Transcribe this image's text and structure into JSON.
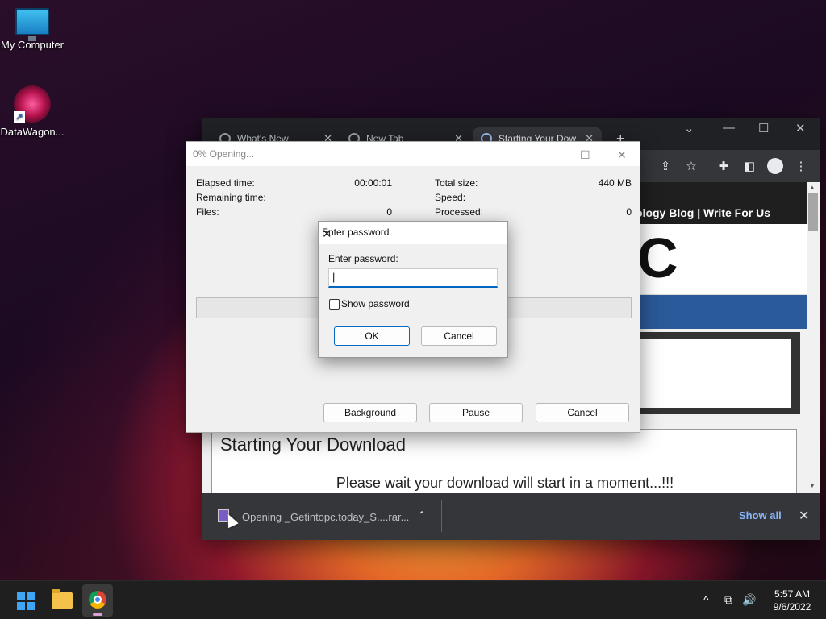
{
  "desktop": {
    "icons": [
      {
        "label": "My Computer",
        "icon": "monitor-icon"
      },
      {
        "label": "DataWagon...",
        "icon": "datawagon-flower-icon"
      }
    ]
  },
  "browser": {
    "tabs": [
      {
        "label": "What's New",
        "close": "✕"
      },
      {
        "label": "New Tab",
        "close": "✕"
      },
      {
        "label": "Starting Your Dow",
        "close": "✕"
      }
    ],
    "new_tab": "+",
    "window_controls": {
      "dropdown": "⌄",
      "minimize": "—",
      "maximize": "☐",
      "close": "✕"
    },
    "toolbar_icons": [
      "share-icon",
      "bookmark-star-icon",
      "extensions-icon",
      "side-panel-icon",
      "profile-icon",
      "menu-icon"
    ],
    "page": {
      "nav_text": "ology Blog | Write For Us",
      "logo_fragment": "C",
      "heading": "Starting Your Download",
      "message": "Please wait your download will start in a moment...!!!"
    },
    "download_bar": {
      "item_text": "Opening _Getintopc.today_S....rar...",
      "chevron": "⌃",
      "show_all": "Show all",
      "close": "✕"
    }
  },
  "opening_dialog": {
    "title": "0% Opening...",
    "controls": {
      "minimize": "—",
      "maximize": "☐",
      "close": "✕"
    },
    "left_labels": [
      "Elapsed time:",
      "Remaining time:",
      "Files:"
    ],
    "left_values": [
      "00:00:01",
      "",
      "0"
    ],
    "right_labels": [
      "Total size:",
      "Speed:",
      "Processed:"
    ],
    "right_values": [
      "440 MB",
      "",
      "0"
    ],
    "progress_fraction": 0.0,
    "buttons": {
      "background": "Background",
      "pause": "Pause",
      "cancel": "Cancel"
    }
  },
  "password_dialog": {
    "title": "Enter password",
    "close": "✕",
    "field_label": "Enter password:",
    "field_value": "",
    "cursor": "|",
    "show_password_label": "Show password",
    "show_password_checked": false,
    "ok": "OK",
    "cancel": "Cancel"
  },
  "taskbar": {
    "apps": [
      "start-icon",
      "file-explorer-icon",
      "chrome-icon"
    ],
    "tray": {
      "overflow": "^",
      "network": "⧉",
      "volume": "🔊"
    },
    "time": "5:57 AM",
    "date": "9/6/2022"
  },
  "colors": {
    "accent": "#0067c0",
    "browser_dark": "#202124",
    "link_blue": "#8ab4f8",
    "progress_green": "#06b025"
  }
}
